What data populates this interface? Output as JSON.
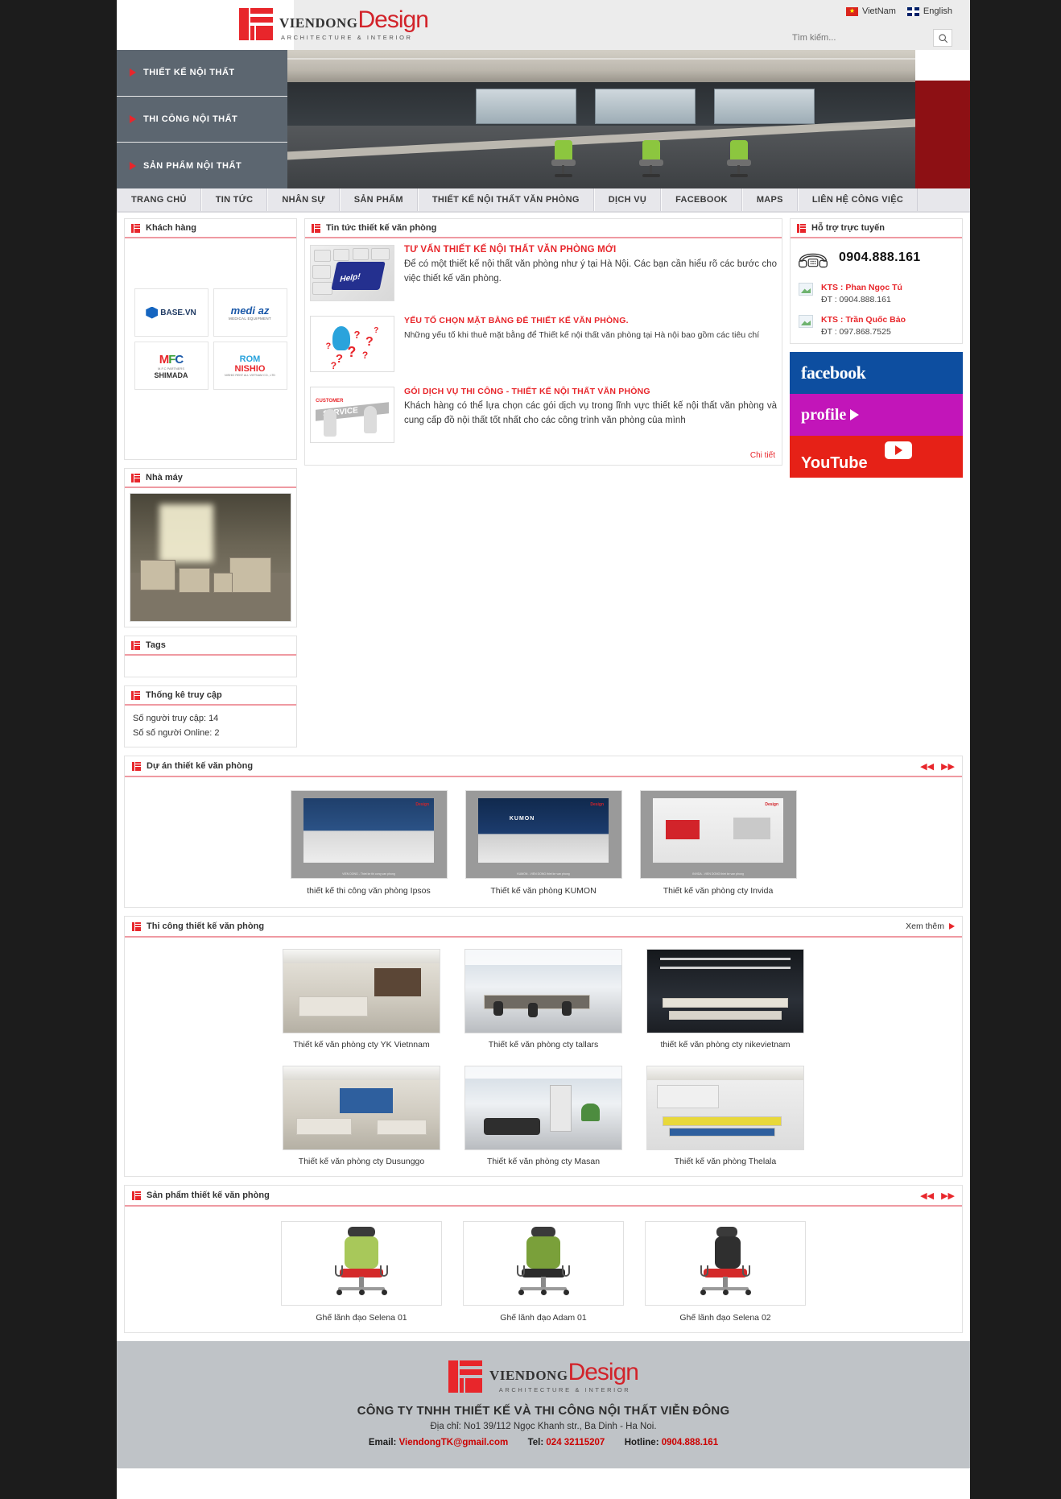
{
  "brand": {
    "name_left": "VIENDONG",
    "name_right": "Design",
    "tagline": "ARCHITECTURE  &  INTERIOR"
  },
  "header": {
    "languages": [
      {
        "label": "VietNam",
        "icon": "vn-flag-icon"
      },
      {
        "label": "English",
        "icon": "uk-flag-icon"
      }
    ],
    "search": {
      "placeholder": "Tìm kiếm...",
      "value": "",
      "icon": "search-icon"
    }
  },
  "hero_menu": [
    {
      "label": "THIẾT KẾ NỘI THẤT"
    },
    {
      "label": "THI CÔNG NỘI THẤT"
    },
    {
      "label": "SẢN PHẨM NỘI THẤT"
    }
  ],
  "topnav": [
    {
      "label": "TRANG CHỦ"
    },
    {
      "label": "TIN TỨC"
    },
    {
      "label": "NHÂN SỰ"
    },
    {
      "label": "SẢN PHẨM"
    },
    {
      "label": "THIẾT KẾ NỘI THẤT VĂN PHÒNG"
    },
    {
      "label": "DỊCH VỤ"
    },
    {
      "label": "FACEBOOK"
    },
    {
      "label": "MAPS"
    },
    {
      "label": "LIÊN HỆ CÔNG VIỆC"
    }
  ],
  "sidebar_left": {
    "customers": {
      "title": "Khách hàng",
      "logos": [
        {
          "name": "BASE.VN",
          "sub": ""
        },
        {
          "name": "medi az",
          "sub": "MEDICAL EQUIPMENT"
        },
        {
          "name": "MFC",
          "sub": "M.F.C PARTNERS",
          "extra": "SHIMADA"
        },
        {
          "name": "NISHIO",
          "sub": "ROM",
          "extra": "NISHIO RENT ALL VIETNAM CO., LTD"
        }
      ]
    },
    "factory": {
      "title": "Nhà máy"
    },
    "tags": {
      "title": "Tags"
    },
    "stats": {
      "title": "Thống kê truy cập",
      "lines": [
        "Số người truy cập: 14",
        "Số số người Online: 2"
      ]
    }
  },
  "news": {
    "title": "Tin tức thiết kế văn phòng",
    "more_label": "Chi tiết",
    "items": [
      {
        "heading": "TƯ VẤN THIẾT KẾ NỘI THẤT VĂN PHÒNG MỚI",
        "body": "Để có một thiết kế nội thất văn phòng như ý tại Hà Nội. Các bạn cần hiểu rõ các bước cho việc thiết kế văn phòng.",
        "thumb": "keyboard-help-icon"
      },
      {
        "heading": "YẾU TỐ CHỌN MẶT BẰNG ĐỂ THIẾT KẾ VĂN PHÒNG.",
        "body": "Những yếu tố khi thuê mặt bằng để Thiết kế nội thất văn phòng tại Hà nội bao gồm các tiêu chí",
        "thumb": "question-marks-icon"
      },
      {
        "heading": "GÓI DỊCH VỤ THI CÔNG - THIẾT KẾ NỘI THẤT VĂN PHÒNG",
        "body": "Khách hàng có thể lựa chọn các gói dịch vụ trong lĩnh vực thiết kế nội thất văn phòng và cung cấp đồ nội thất tốt nhất cho các công trình văn phòng của mình",
        "thumb": "customer-service-icon"
      }
    ]
  },
  "support": {
    "title": "Hỗ trợ trực tuyến",
    "hotline": "0904.888.161",
    "phone_icon": "telephone-icon",
    "people": [
      {
        "name": "KTS : Phan Ngọc Tú",
        "tel": "ĐT : 0904.888.161"
      },
      {
        "name": "KTS : Trần Quốc Bảo",
        "tel": "ĐT : 097.868.7525"
      }
    ],
    "social": [
      {
        "label": "facebook",
        "key": "facebook"
      },
      {
        "label": "profile",
        "key": "profile"
      },
      {
        "label": "YouTube",
        "key": "youtube"
      }
    ]
  },
  "projects": {
    "title": "Dự án thiết kế văn phòng",
    "prev_icon": "prev-arrows-icon",
    "next_icon": "next-arrows-icon",
    "items": [
      {
        "caption": "thiết kế thi công văn phòng Ipsos"
      },
      {
        "caption": "Thiết kế văn phòng KUMON"
      },
      {
        "caption": "Thiết kế văn phòng cty Invida"
      }
    ]
  },
  "construction": {
    "title": "Thi công thiết kế văn phòng",
    "more_label": "Xem thêm",
    "items": [
      {
        "caption": "Thiết kế văn phòng cty YK Vietnnam"
      },
      {
        "caption": "Thiết kế văn phòng cty tallars"
      },
      {
        "caption": "thiết kế văn phòng cty nikevietnam"
      },
      {
        "caption": "Thiết kế văn phòng cty Dusunggo"
      },
      {
        "caption": "Thiết kế văn phòng cty Masan"
      },
      {
        "caption": "Thiết kế văn phòng Thelala"
      }
    ]
  },
  "products": {
    "title": "Sản phẩm thiết kế văn phòng",
    "prev_icon": "prev-arrows-icon",
    "next_icon": "next-arrows-icon",
    "items": [
      {
        "caption": "Ghế lãnh đạo Selena 01"
      },
      {
        "caption": "Ghế lãnh đạo Adam 01"
      },
      {
        "caption": "Ghế lãnh đạo Selena 02"
      }
    ]
  },
  "footer": {
    "company": "CÔNG TY TNHH THIẾT KẾ VÀ THI CÔNG NỘI THẤT VIỄN ĐÔNG",
    "address": "Địa chỉ: No1 39/112 Ngọc Khanh str., Ba Dinh - Ha Noi.",
    "email_label": "Email:",
    "email_value": "ViendongTK@gmail.com",
    "tel_label": "Tel:",
    "tel_value": "024 32115207",
    "hotline_label": "Hotline:",
    "hotline_value": "0904.888.161"
  },
  "colors": {
    "brand_red": "#e8262b",
    "menu_gray": "#5c6670",
    "facebook_blue": "#0d4ea0",
    "profile_magenta": "#c215b9",
    "youtube_red": "#e62117"
  }
}
